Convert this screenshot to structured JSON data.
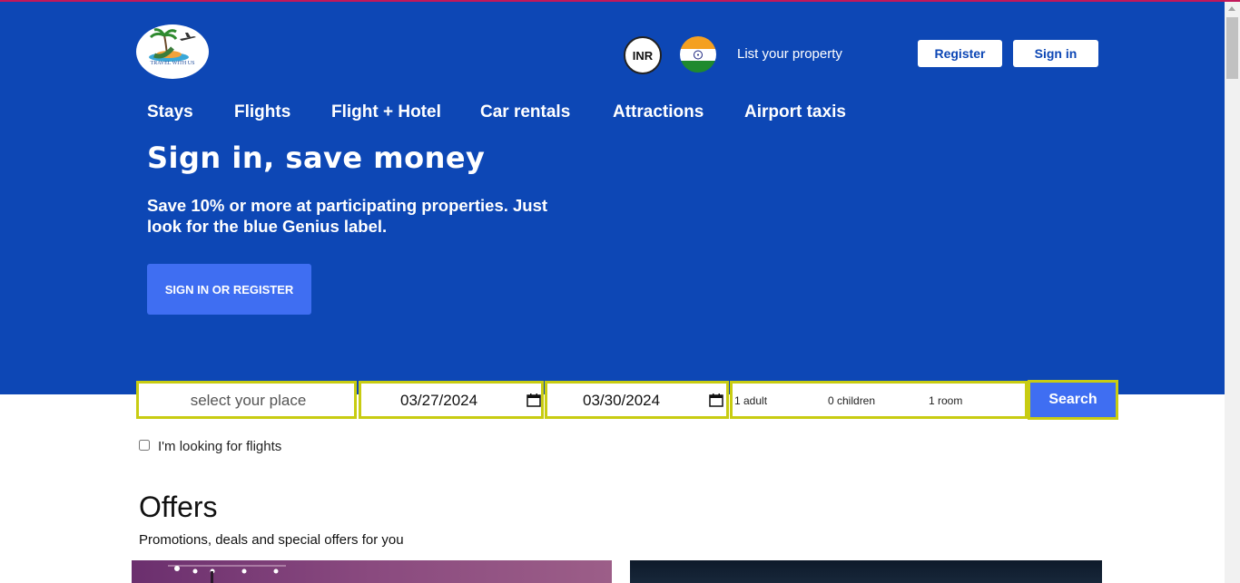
{
  "header": {
    "logo_alt_text": "TRAVEL WITH US",
    "currency": "INR",
    "list_property": "List your property",
    "register_label": "Register",
    "signin_label": "Sign in"
  },
  "nav": {
    "items": [
      "Stays",
      "Flights",
      "Flight + Hotel",
      "Car rentals",
      "Attractions",
      "Airport taxis"
    ]
  },
  "hero": {
    "title": "Sign in, save money",
    "subtitle": "Save 10% or more at participating properties. Just look for the blue Genius label.",
    "cta_label": "SIGN IN OR REGISTER"
  },
  "search": {
    "place_placeholder": "select your place",
    "checkin": "03/27/2024",
    "checkout": "03/30/2024",
    "adults": "1 adult",
    "children": "0 children",
    "rooms": "1 room",
    "button_label": "Search",
    "flights_checkbox_label": "I'm looking for flights",
    "flights_checked": false
  },
  "offers": {
    "title": "Offers",
    "subtitle": "Promotions, deals and special offers for you"
  },
  "colors": {
    "hero_bg": "#0d47b5",
    "accent_button": "#3f6ef2",
    "search_border": "#c8cc12",
    "top_line": "#c2185b"
  },
  "icons": [
    "logo-palm-plane-icon",
    "india-flag-icon",
    "calendar-icon"
  ]
}
